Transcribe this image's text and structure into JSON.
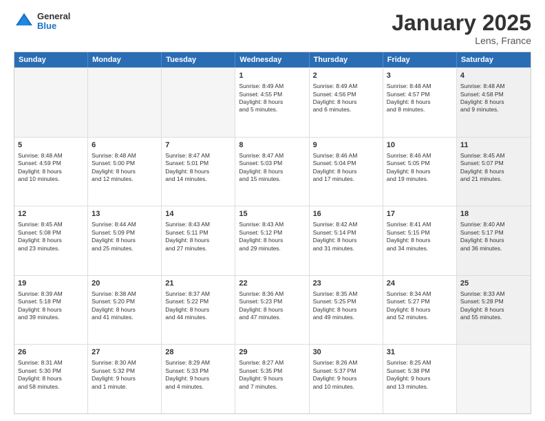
{
  "header": {
    "logo_general": "General",
    "logo_blue": "Blue",
    "title": "January 2025",
    "subtitle": "Lens, France"
  },
  "weekdays": [
    "Sunday",
    "Monday",
    "Tuesday",
    "Wednesday",
    "Thursday",
    "Friday",
    "Saturday"
  ],
  "rows": [
    [
      {
        "day": "",
        "info": "",
        "shaded": true,
        "empty": true
      },
      {
        "day": "",
        "info": "",
        "shaded": true,
        "empty": true
      },
      {
        "day": "",
        "info": "",
        "shaded": true,
        "empty": true
      },
      {
        "day": "1",
        "info": "Sunrise: 8:49 AM\nSunset: 4:55 PM\nDaylight: 8 hours\nand 5 minutes.",
        "shaded": false
      },
      {
        "day": "2",
        "info": "Sunrise: 8:49 AM\nSunset: 4:56 PM\nDaylight: 8 hours\nand 6 minutes.",
        "shaded": false
      },
      {
        "day": "3",
        "info": "Sunrise: 8:48 AM\nSunset: 4:57 PM\nDaylight: 8 hours\nand 8 minutes.",
        "shaded": false
      },
      {
        "day": "4",
        "info": "Sunrise: 8:48 AM\nSunset: 4:58 PM\nDaylight: 8 hours\nand 9 minutes.",
        "shaded": true
      }
    ],
    [
      {
        "day": "5",
        "info": "Sunrise: 8:48 AM\nSunset: 4:59 PM\nDaylight: 8 hours\nand 10 minutes.",
        "shaded": false
      },
      {
        "day": "6",
        "info": "Sunrise: 8:48 AM\nSunset: 5:00 PM\nDaylight: 8 hours\nand 12 minutes.",
        "shaded": false
      },
      {
        "day": "7",
        "info": "Sunrise: 8:47 AM\nSunset: 5:01 PM\nDaylight: 8 hours\nand 14 minutes.",
        "shaded": false
      },
      {
        "day": "8",
        "info": "Sunrise: 8:47 AM\nSunset: 5:03 PM\nDaylight: 8 hours\nand 15 minutes.",
        "shaded": false
      },
      {
        "day": "9",
        "info": "Sunrise: 8:46 AM\nSunset: 5:04 PM\nDaylight: 8 hours\nand 17 minutes.",
        "shaded": false
      },
      {
        "day": "10",
        "info": "Sunrise: 8:46 AM\nSunset: 5:05 PM\nDaylight: 8 hours\nand 19 minutes.",
        "shaded": false
      },
      {
        "day": "11",
        "info": "Sunrise: 8:45 AM\nSunset: 5:07 PM\nDaylight: 8 hours\nand 21 minutes.",
        "shaded": true
      }
    ],
    [
      {
        "day": "12",
        "info": "Sunrise: 8:45 AM\nSunset: 5:08 PM\nDaylight: 8 hours\nand 23 minutes.",
        "shaded": false
      },
      {
        "day": "13",
        "info": "Sunrise: 8:44 AM\nSunset: 5:09 PM\nDaylight: 8 hours\nand 25 minutes.",
        "shaded": false
      },
      {
        "day": "14",
        "info": "Sunrise: 8:43 AM\nSunset: 5:11 PM\nDaylight: 8 hours\nand 27 minutes.",
        "shaded": false
      },
      {
        "day": "15",
        "info": "Sunrise: 8:43 AM\nSunset: 5:12 PM\nDaylight: 8 hours\nand 29 minutes.",
        "shaded": false
      },
      {
        "day": "16",
        "info": "Sunrise: 8:42 AM\nSunset: 5:14 PM\nDaylight: 8 hours\nand 31 minutes.",
        "shaded": false
      },
      {
        "day": "17",
        "info": "Sunrise: 8:41 AM\nSunset: 5:15 PM\nDaylight: 8 hours\nand 34 minutes.",
        "shaded": false
      },
      {
        "day": "18",
        "info": "Sunrise: 8:40 AM\nSunset: 5:17 PM\nDaylight: 8 hours\nand 36 minutes.",
        "shaded": true
      }
    ],
    [
      {
        "day": "19",
        "info": "Sunrise: 8:39 AM\nSunset: 5:18 PM\nDaylight: 8 hours\nand 39 minutes.",
        "shaded": false
      },
      {
        "day": "20",
        "info": "Sunrise: 8:38 AM\nSunset: 5:20 PM\nDaylight: 8 hours\nand 41 minutes.",
        "shaded": false
      },
      {
        "day": "21",
        "info": "Sunrise: 8:37 AM\nSunset: 5:22 PM\nDaylight: 8 hours\nand 44 minutes.",
        "shaded": false
      },
      {
        "day": "22",
        "info": "Sunrise: 8:36 AM\nSunset: 5:23 PM\nDaylight: 8 hours\nand 47 minutes.",
        "shaded": false
      },
      {
        "day": "23",
        "info": "Sunrise: 8:35 AM\nSunset: 5:25 PM\nDaylight: 8 hours\nand 49 minutes.",
        "shaded": false
      },
      {
        "day": "24",
        "info": "Sunrise: 8:34 AM\nSunset: 5:27 PM\nDaylight: 8 hours\nand 52 minutes.",
        "shaded": false
      },
      {
        "day": "25",
        "info": "Sunrise: 8:33 AM\nSunset: 5:28 PM\nDaylight: 8 hours\nand 55 minutes.",
        "shaded": true
      }
    ],
    [
      {
        "day": "26",
        "info": "Sunrise: 8:31 AM\nSunset: 5:30 PM\nDaylight: 8 hours\nand 58 minutes.",
        "shaded": false
      },
      {
        "day": "27",
        "info": "Sunrise: 8:30 AM\nSunset: 5:32 PM\nDaylight: 9 hours\nand 1 minute.",
        "shaded": false
      },
      {
        "day": "28",
        "info": "Sunrise: 8:29 AM\nSunset: 5:33 PM\nDaylight: 9 hours\nand 4 minutes.",
        "shaded": false
      },
      {
        "day": "29",
        "info": "Sunrise: 8:27 AM\nSunset: 5:35 PM\nDaylight: 9 hours\nand 7 minutes.",
        "shaded": false
      },
      {
        "day": "30",
        "info": "Sunrise: 8:26 AM\nSunset: 5:37 PM\nDaylight: 9 hours\nand 10 minutes.",
        "shaded": false
      },
      {
        "day": "31",
        "info": "Sunrise: 8:25 AM\nSunset: 5:38 PM\nDaylight: 9 hours\nand 13 minutes.",
        "shaded": false
      },
      {
        "day": "",
        "info": "",
        "shaded": true,
        "empty": true
      }
    ]
  ]
}
